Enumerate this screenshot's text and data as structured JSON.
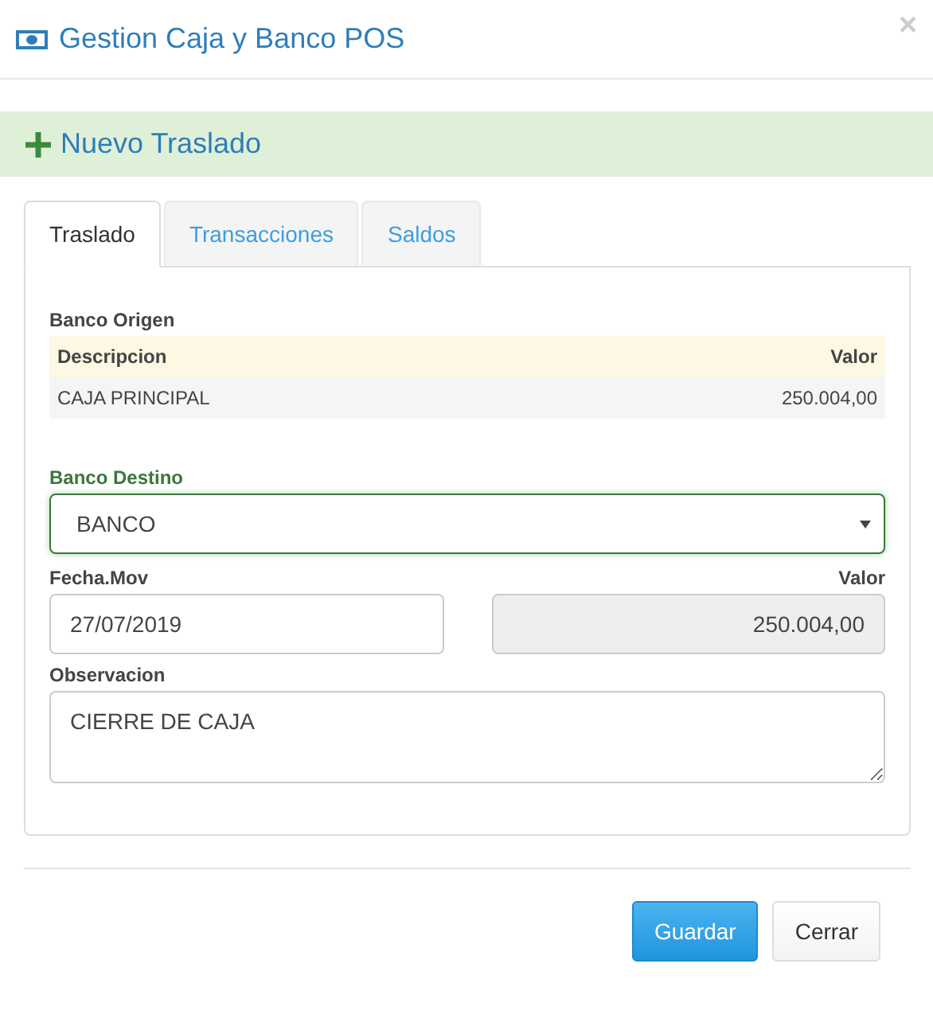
{
  "modal": {
    "title": "Gestion Caja y Banco POS",
    "close": "×"
  },
  "banner": {
    "title": "Nuevo Traslado"
  },
  "tabs": [
    {
      "label": "Traslado",
      "selected": true
    },
    {
      "label": "Transacciones",
      "selected": false
    },
    {
      "label": "Saldos",
      "selected": false
    }
  ],
  "origin": {
    "label": "Banco Origen",
    "columns": [
      "Descripcion",
      "Valor"
    ],
    "rows": [
      [
        "CAJA PRINCIPAL",
        "250.004,00"
      ]
    ]
  },
  "destination": {
    "label": "Banco Destino",
    "value": "BANCO",
    "valid": true
  },
  "date": {
    "label": "Fecha.Mov",
    "value": "27/07/2019"
  },
  "amount": {
    "label": "Valor",
    "value": "250.004,00",
    "disabled": true
  },
  "notes": {
    "label": "Observacion",
    "value": "CIERRE DE CAJA"
  },
  "buttons": [
    {
      "label": "Guardar",
      "kind": "primary"
    },
    {
      "label": "Cerrar",
      "kind": "default"
    }
  ]
}
